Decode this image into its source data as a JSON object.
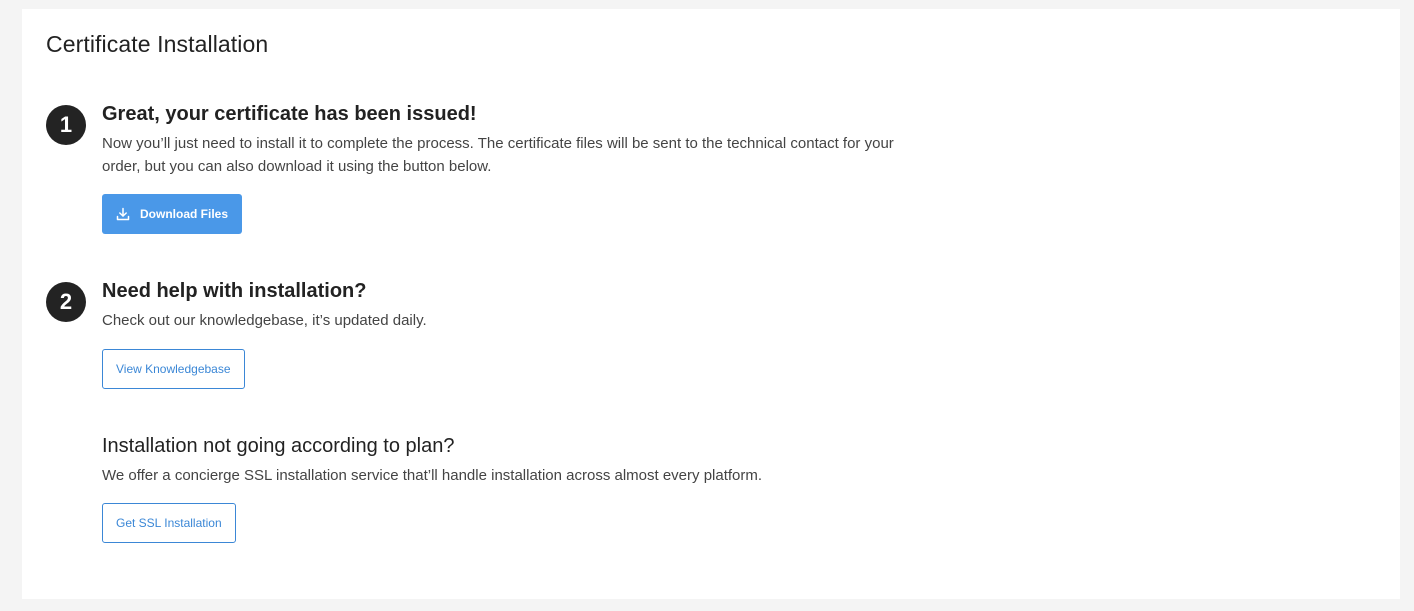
{
  "page": {
    "title": "Certificate Installation"
  },
  "step1": {
    "number": "1",
    "heading": "Great, your certificate has been issued!",
    "description": "Now you’ll just need to install it to complete the process. The certificate files will be sent to the technical contact for your order, but you can also download it using the button below.",
    "button_label": "Download Files",
    "button_icon": "download-icon"
  },
  "step2": {
    "number": "2",
    "heading": "Need help with installation?",
    "description": "Check out our knowledgebase, it’s updated daily.",
    "button_label": "View Knowledgebase"
  },
  "step3": {
    "heading": "Installation not going according to plan?",
    "description": "We offer a concierge SSL installation service that’ll handle installation across almost every platform.",
    "button_label": "Get SSL Installation"
  },
  "colors": {
    "primary": "#4a98e8",
    "outline": "#3b87d6",
    "step_badge": "#232323",
    "background": "#f4f4f4"
  }
}
